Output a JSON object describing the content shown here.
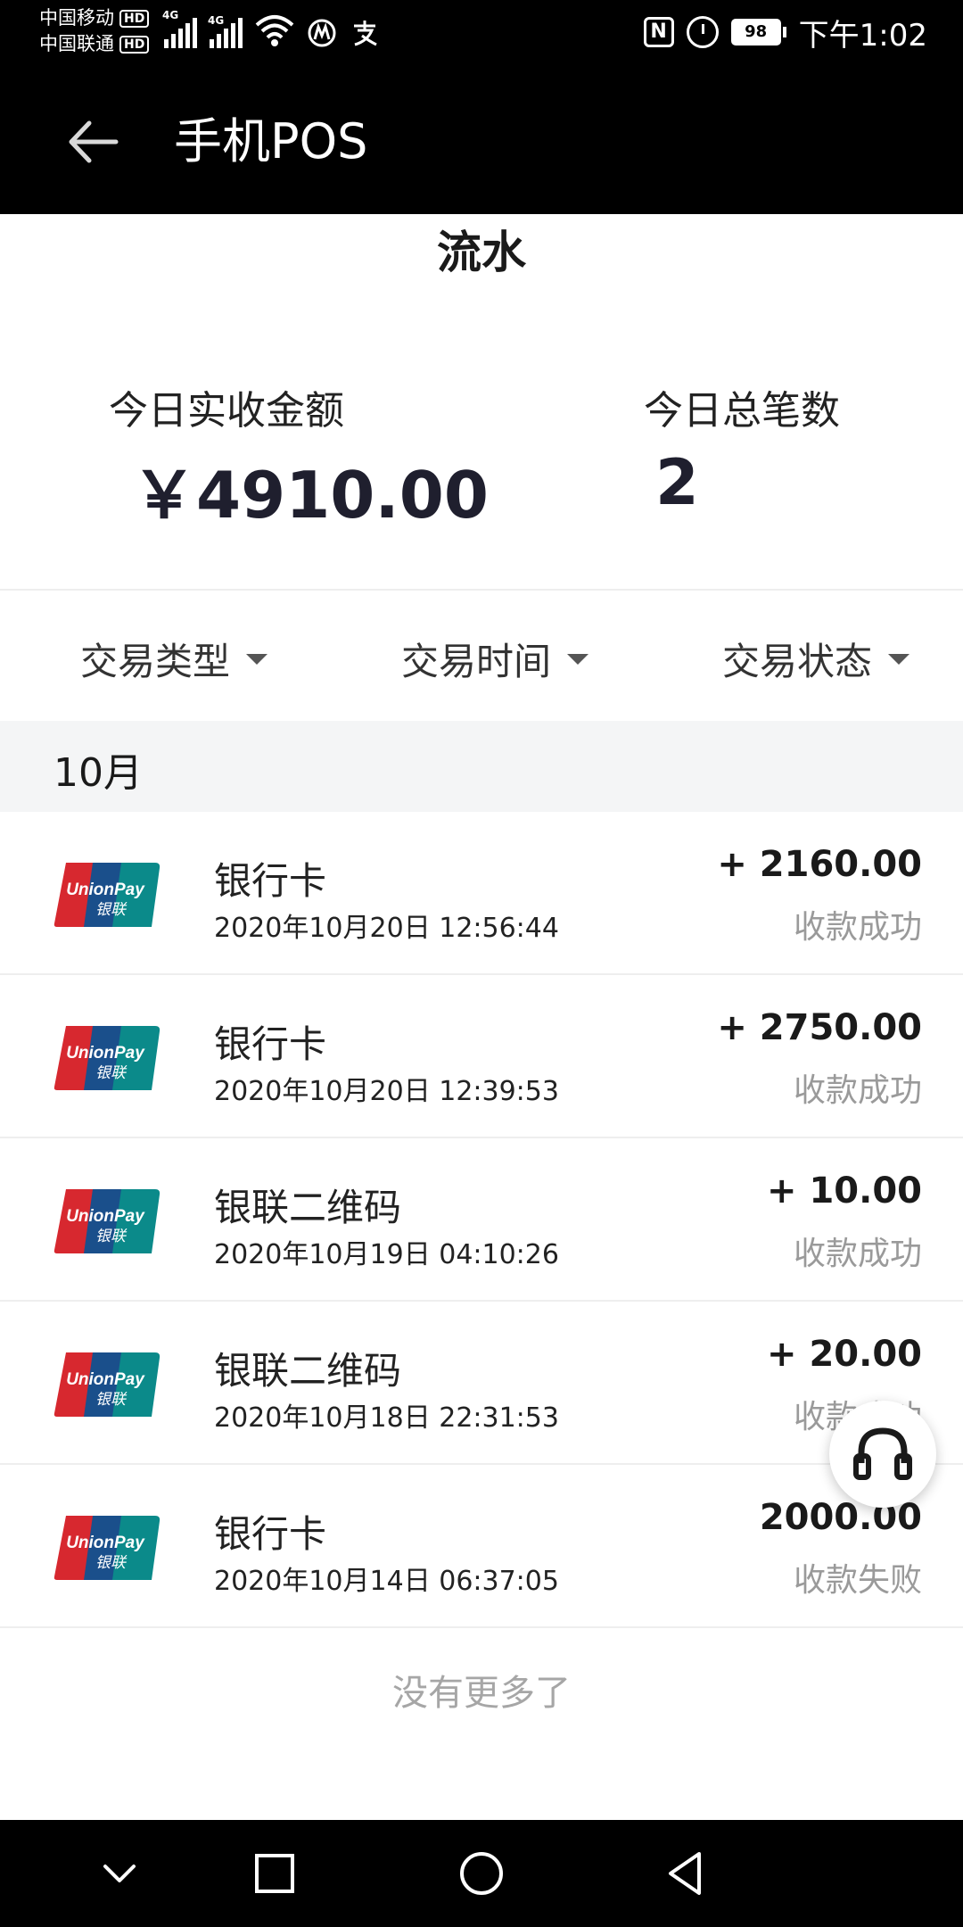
{
  "status_bar": {
    "carrier_1": "中国移动",
    "carrier_2": "中国联通",
    "hd_badge": "HD",
    "network_1": "4G",
    "network_2": "4G",
    "battery_level": "98",
    "time": "下午1:02"
  },
  "app_bar": {
    "title": "手机POS"
  },
  "page": {
    "title": "流水"
  },
  "summary": {
    "amount_label": "今日实收金额",
    "amount_value": "￥4910.00",
    "count_label": "今日总笔数",
    "count_value": "2"
  },
  "filters": [
    {
      "label": "交易类型"
    },
    {
      "label": "交易时间"
    },
    {
      "label": "交易状态"
    }
  ],
  "month_header": "10月",
  "transactions": [
    {
      "type": "银行卡",
      "datetime": "2020年10月20日 12:56:44",
      "amount": "+ 2160.00",
      "status": "收款成功",
      "logo": "unionpay-logo"
    },
    {
      "type": "银行卡",
      "datetime": "2020年10月20日 12:39:53",
      "amount": "+ 2750.00",
      "status": "收款成功",
      "logo": "unionpay-logo"
    },
    {
      "type": "银联二维码",
      "datetime": "2020年10月19日 04:10:26",
      "amount": "+ 10.00",
      "status": "收款成功",
      "logo": "unionpay-logo"
    },
    {
      "type": "银联二维码",
      "datetime": "2020年10月18日 22:31:53",
      "amount": "+ 20.00",
      "status": "收款成功",
      "logo": "unionpay-logo"
    },
    {
      "type": "银行卡",
      "datetime": "2020年10月14日 06:37:05",
      "amount": "2000.00",
      "status": "收款失败",
      "logo": "unionpay-logo"
    }
  ],
  "footer": {
    "no_more": "没有更多了"
  },
  "icons": {
    "back": "arrow-left-icon",
    "support": "headset-icon",
    "nav_down": "chevron-down-icon",
    "nav_recent": "square-icon",
    "nav_home": "circle-icon",
    "nav_back": "triangle-left-icon"
  },
  "colors": {
    "header_bg": "#000000",
    "month_bg": "#f4f5f6",
    "status_gray": "#9a9a9a",
    "unionpay_red": "#d7282f",
    "unionpay_blue": "#1a4f8b",
    "unionpay_teal": "#0b8a8a"
  }
}
